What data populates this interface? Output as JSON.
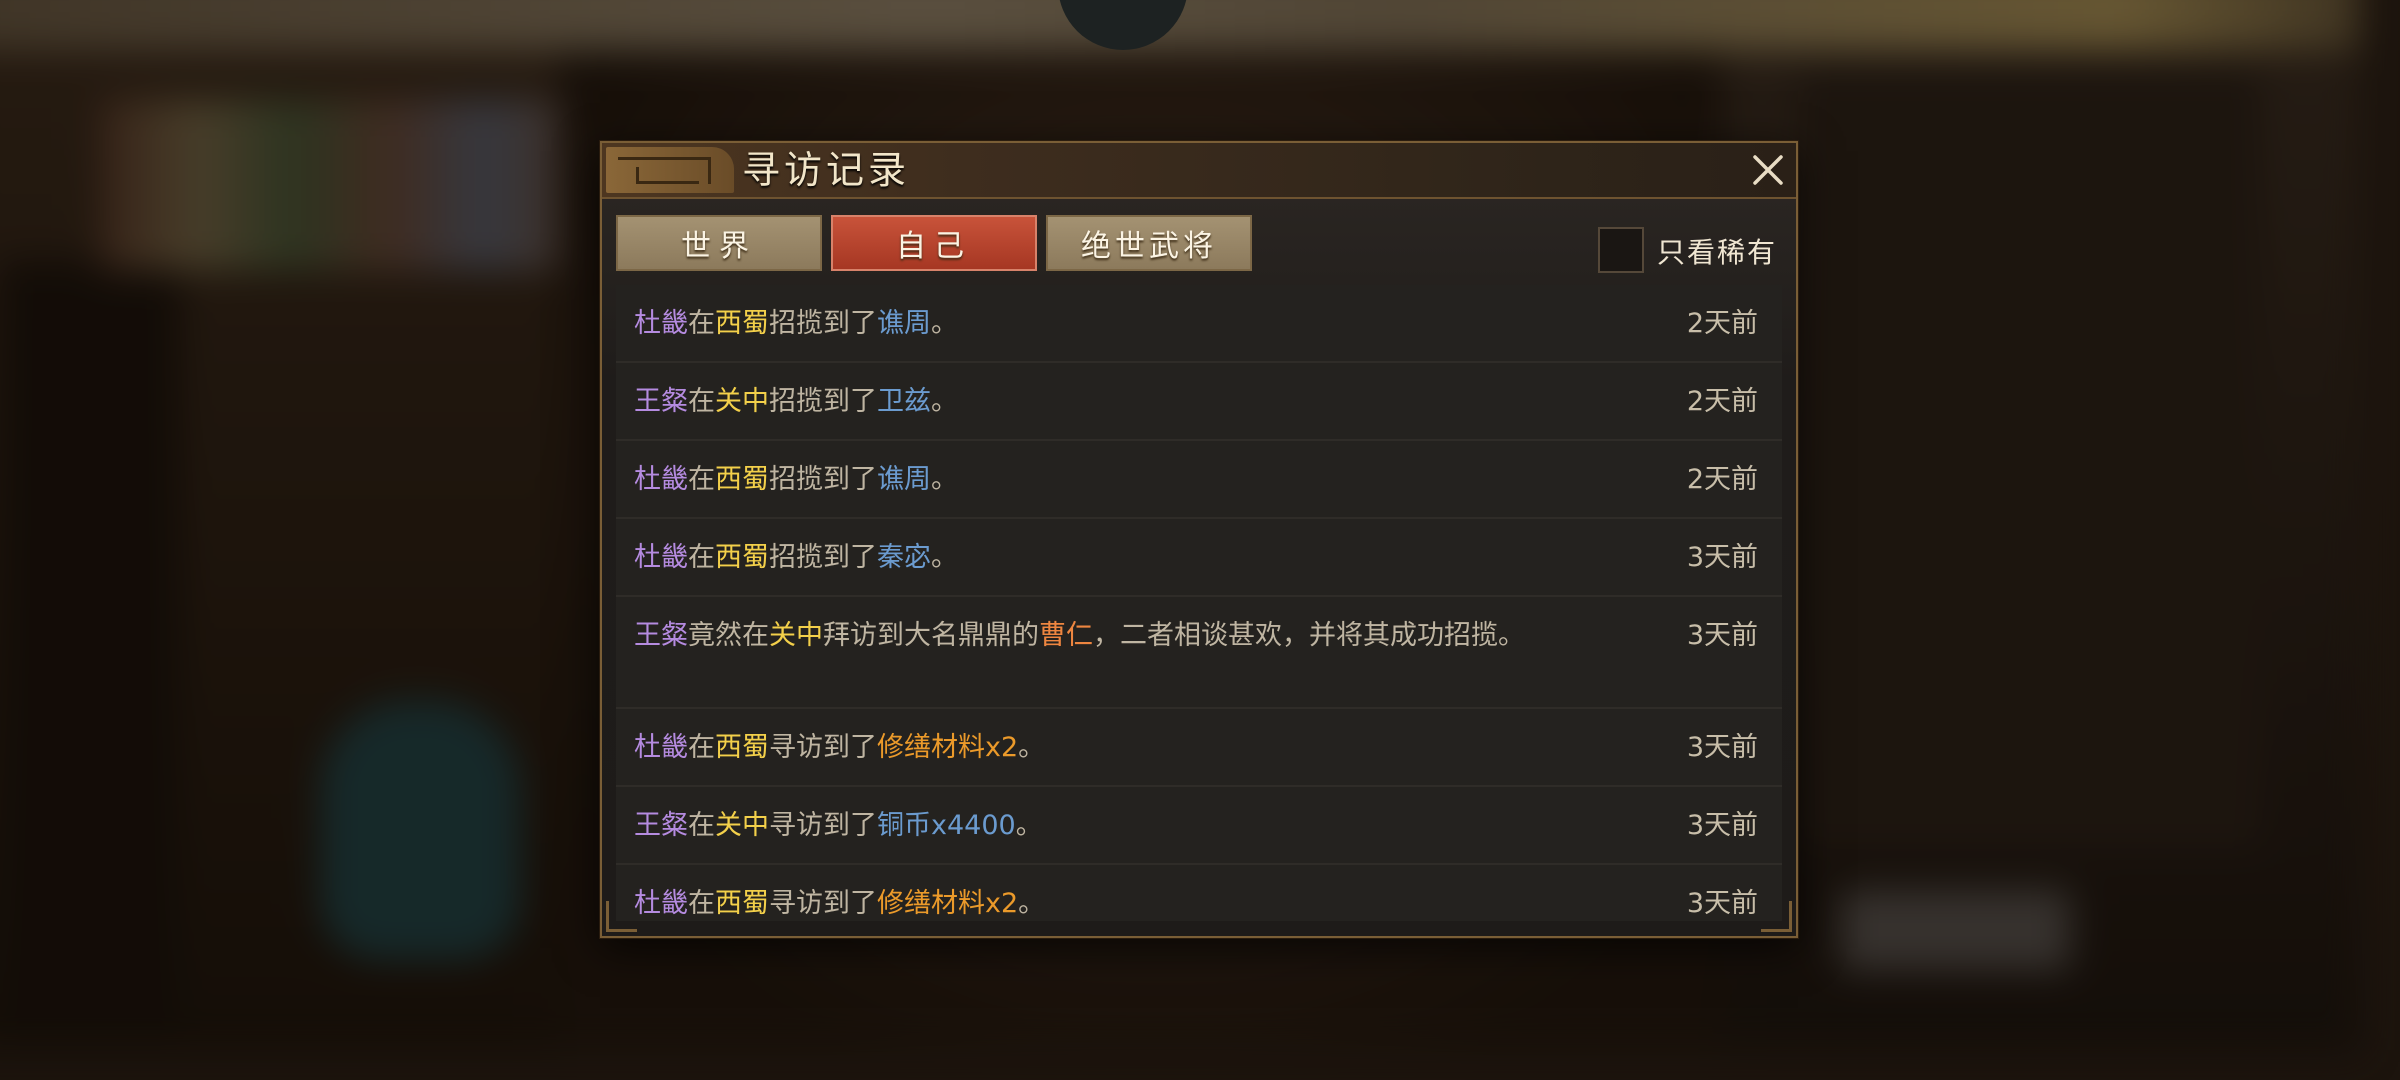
{
  "dialog": {
    "title": "寻访记录",
    "tabs": [
      {
        "label": "世界",
        "active": false
      },
      {
        "label": "自己",
        "active": true
      },
      {
        "label": "绝世武将",
        "active": false
      }
    ],
    "rare_only_label": "只看稀有",
    "rare_only_checked": false
  },
  "colors": {
    "person": "#b58be0",
    "place": "#f3d04a",
    "general": "#6b9bcf",
    "item": "#eb9a2a",
    "famous": "#ee8640",
    "active_tab": "#b8442e"
  },
  "records": [
    {
      "person": "杜畿",
      "w1": "在",
      "place": "西蜀",
      "w2": "招揽到了",
      "target": "谯周",
      "end": "。",
      "time": "2天前"
    },
    {
      "person": "王粲",
      "w1": "在",
      "place": "关中",
      "w2": "招揽到了",
      "target": "卫兹",
      "end": "。",
      "time": "2天前"
    },
    {
      "person": "杜畿",
      "w1": "在",
      "place": "西蜀",
      "w2": "招揽到了",
      "target": "谯周",
      "end": "。",
      "time": "2天前"
    },
    {
      "person": "杜畿",
      "w1": "在",
      "place": "西蜀",
      "w2": "招揽到了",
      "target": "秦宓",
      "end": "。",
      "time": "3天前"
    },
    {
      "person": "王粲",
      "w1": "竟然在",
      "place": "关中",
      "w2": "拜访到大名鼎鼎的",
      "target": "曹仁",
      "end": "，二者相谈甚欢，并将其成功招揽。",
      "time": "3天前"
    },
    {
      "person": "杜畿",
      "w1": "在",
      "place": "西蜀",
      "w2": "寻访到了",
      "target": "修缮材料x2",
      "end": "。",
      "time": "3天前"
    },
    {
      "person": "王粲",
      "w1": "在",
      "place": "关中",
      "w2": "寻访到了",
      "target": "铜币x4400",
      "end": "。",
      "time": "3天前"
    },
    {
      "person": "杜畿",
      "w1": "在",
      "place": "西蜀",
      "w2": "寻访到了",
      "target": "修缮材料x2",
      "end": "。",
      "time": "3天前"
    }
  ]
}
